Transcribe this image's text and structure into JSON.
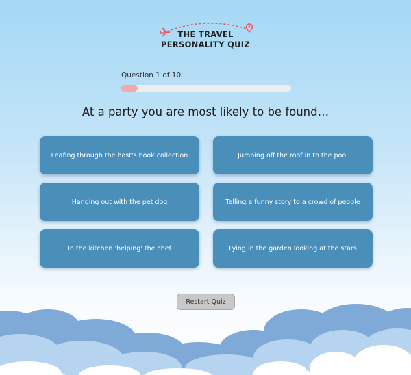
{
  "logo": {
    "title_line1": "THE TRAVEL",
    "title_line2": "PERSONALITY QUIZ",
    "accent_color": "#e8585a"
  },
  "progress": {
    "label": "Question 1 of 10",
    "current": 1,
    "total": 10
  },
  "question": {
    "text": "At a party you are most likely to be found…"
  },
  "answers": [
    "Leafing through the host's book collection",
    "Jumping off the roof in to the pool",
    "Hanging out with the pet dog",
    "Telling a funny story to a crowd of people",
    "In the kitchen 'helping' the chef",
    "Lying in the garden looking at the stars"
  ],
  "restart": {
    "label": "Restart Quiz"
  },
  "colors": {
    "answer_button": "#4a8fba",
    "progress_fill": "#f3a9ab",
    "progress_track": "#eceef1",
    "sky_top": "#a4d8f5",
    "cloud_dark": "#7fa9d6",
    "cloud_mid": "#b6d4ef",
    "cloud_light": "#ffffff"
  }
}
